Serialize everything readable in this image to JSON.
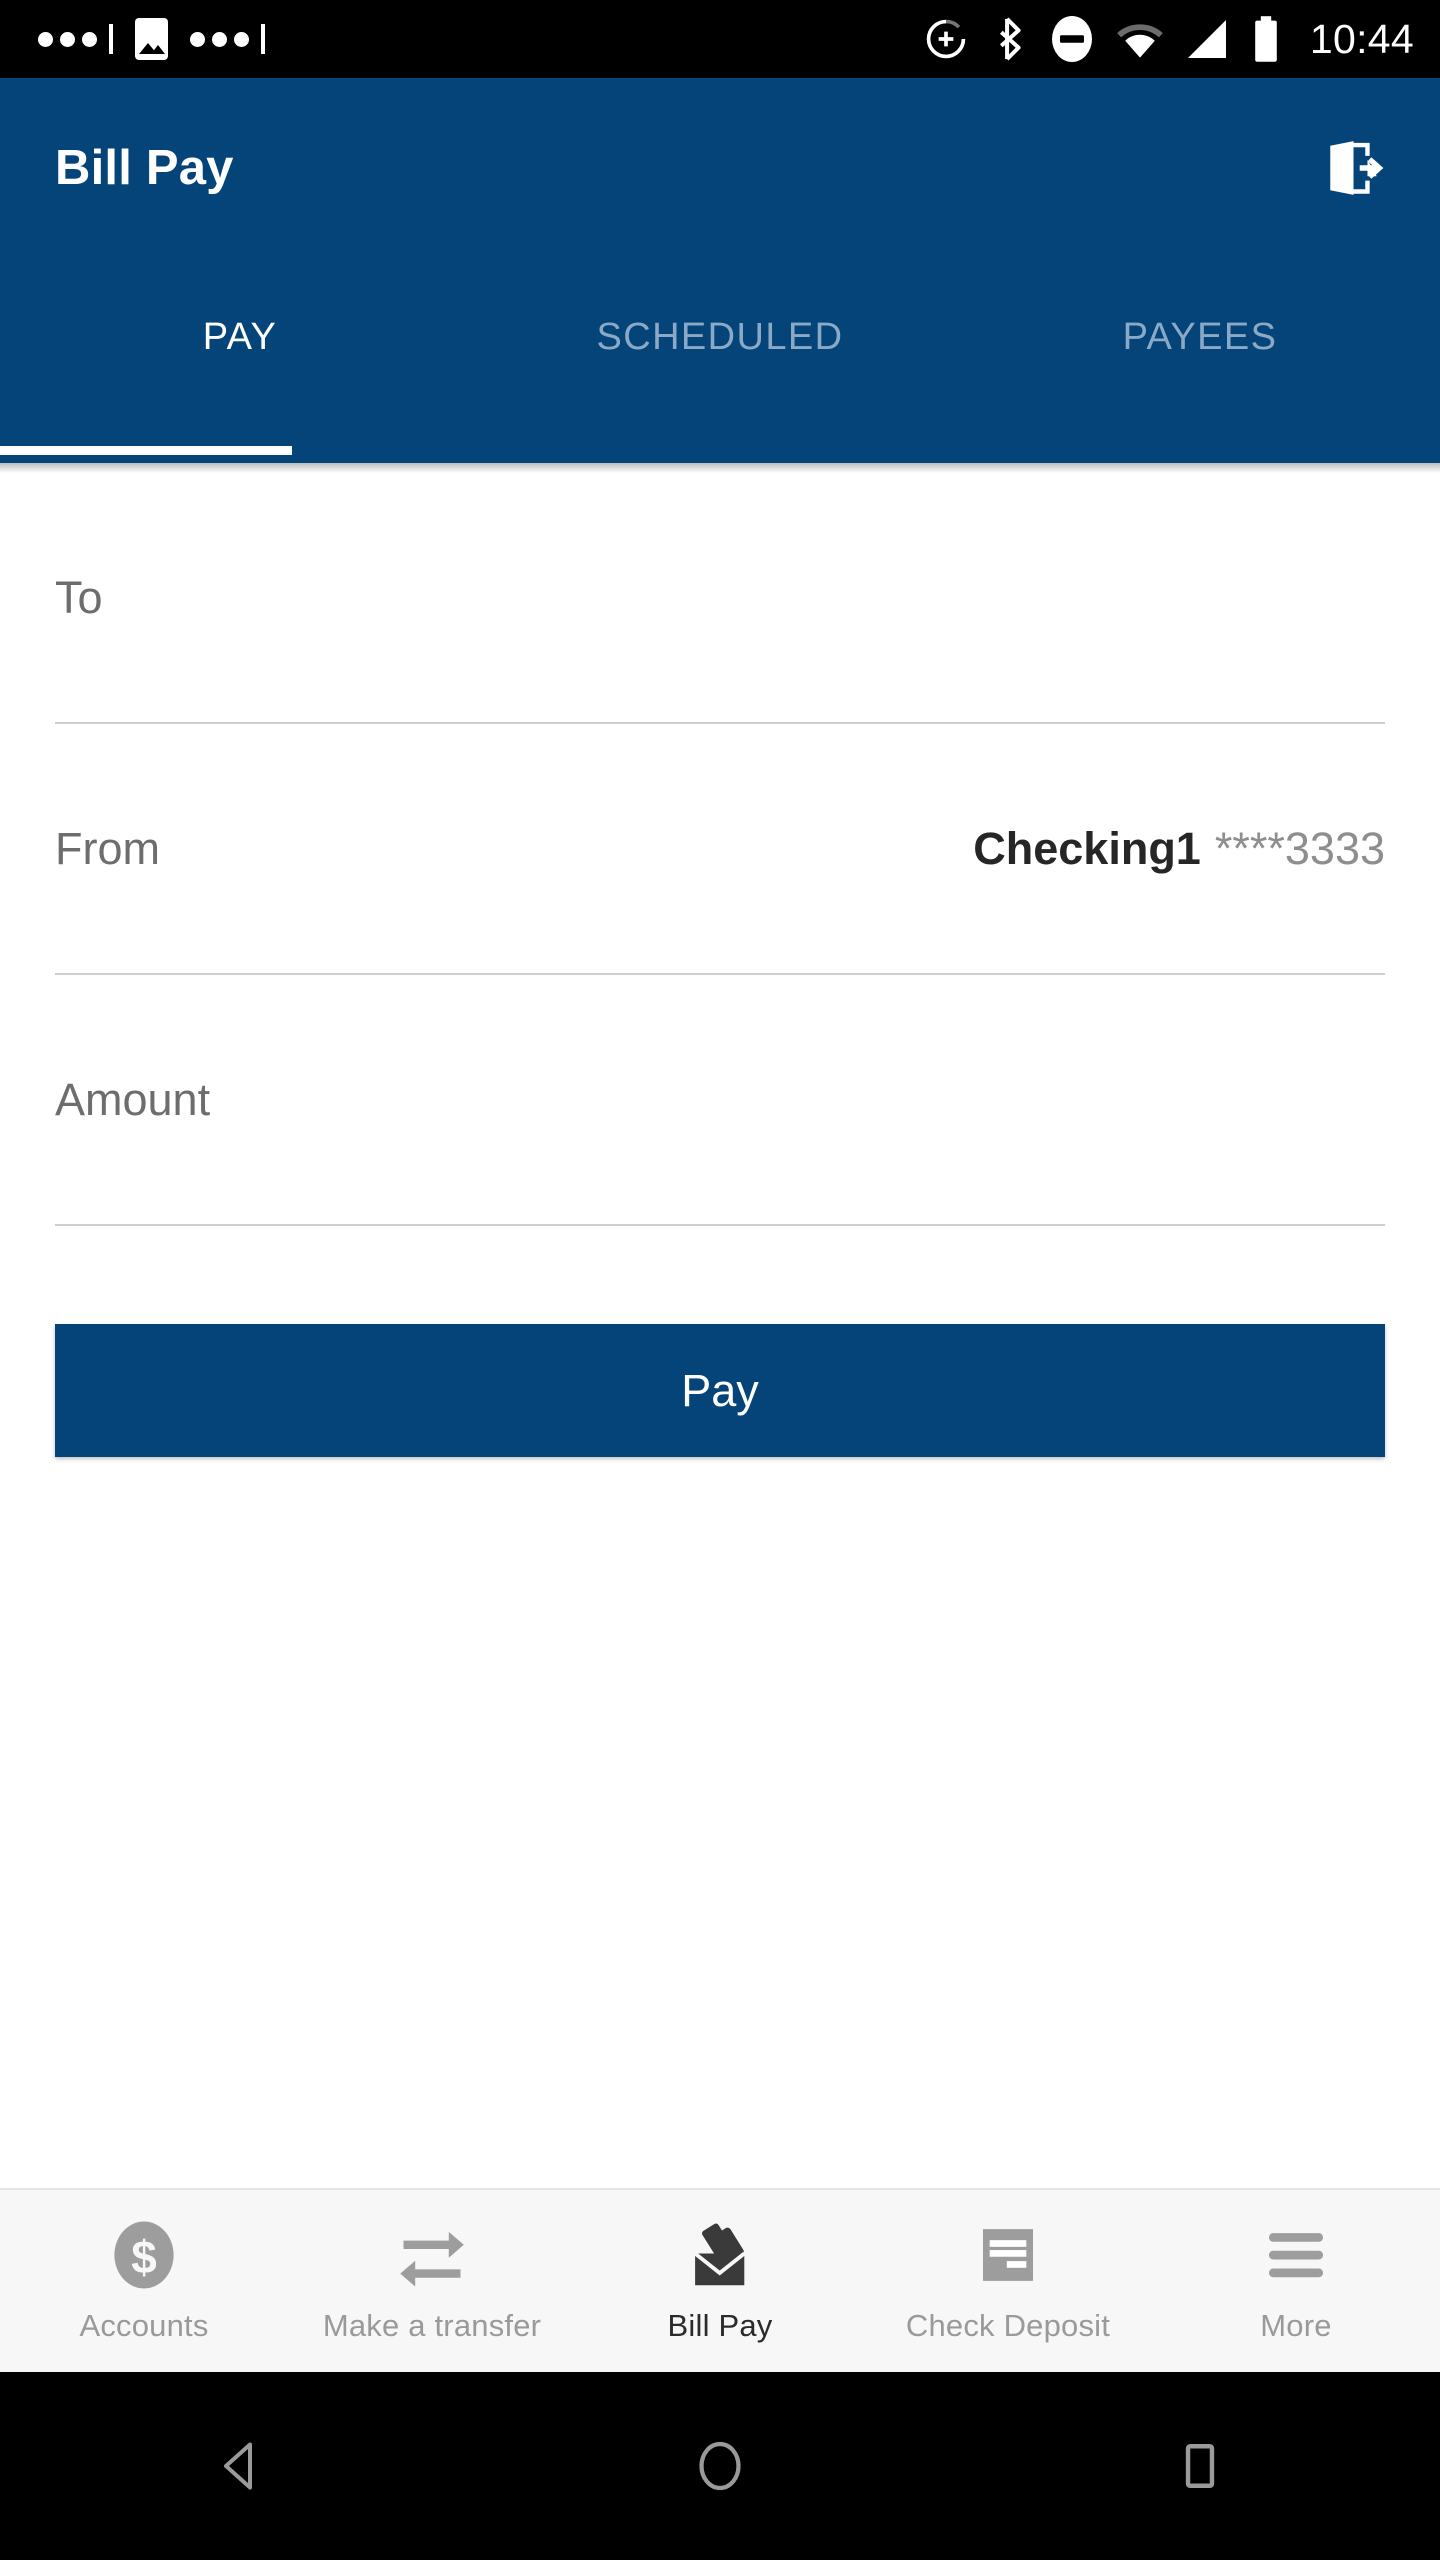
{
  "status_bar": {
    "time": "10:44",
    "left_icons": [
      "more-dots-icon",
      "image-icon",
      "more-dots-icon"
    ],
    "right_icons": [
      "data-saver-icon",
      "bluetooth-icon",
      "do-not-disturb-icon",
      "wifi-icon",
      "cellular-signal-icon",
      "battery-icon"
    ]
  },
  "appbar": {
    "title": "Bill Pay",
    "logout_icon": "logout-icon",
    "background_color": "#044479",
    "tabs": [
      {
        "label": "PAY",
        "active": true
      },
      {
        "label": "SCHEDULED",
        "active": false
      },
      {
        "label": "PAYEES",
        "active": false
      }
    ]
  },
  "form": {
    "fields": [
      {
        "label": "To",
        "value": "",
        "value_bold": "",
        "value_muted": ""
      },
      {
        "label": "From",
        "value_bold": "Checking1",
        "value_muted": "****3333"
      },
      {
        "label": "Amount",
        "value": "",
        "value_bold": "",
        "value_muted": ""
      }
    ],
    "submit_label": "Pay"
  },
  "bottom_nav": {
    "items": [
      {
        "label": "Accounts",
        "icon": "dollar-circle-icon",
        "active": false
      },
      {
        "label": "Make a transfer",
        "icon": "transfer-arrows-icon",
        "active": false
      },
      {
        "label": "Bill Pay",
        "icon": "envelope-bill-icon",
        "active": true
      },
      {
        "label": "Check Deposit",
        "icon": "check-document-icon",
        "active": false
      },
      {
        "label": "More",
        "icon": "hamburger-menu-icon",
        "active": false
      }
    ]
  },
  "android_nav": {
    "back": "back-triangle-icon",
    "home": "home-circle-icon",
    "recents": "recents-square-icon"
  },
  "colors": {
    "brand_blue": "#044479",
    "label_gray": "#6d6d6d",
    "value_dark": "#262626",
    "nav_inactive": "#9a9a9a"
  }
}
